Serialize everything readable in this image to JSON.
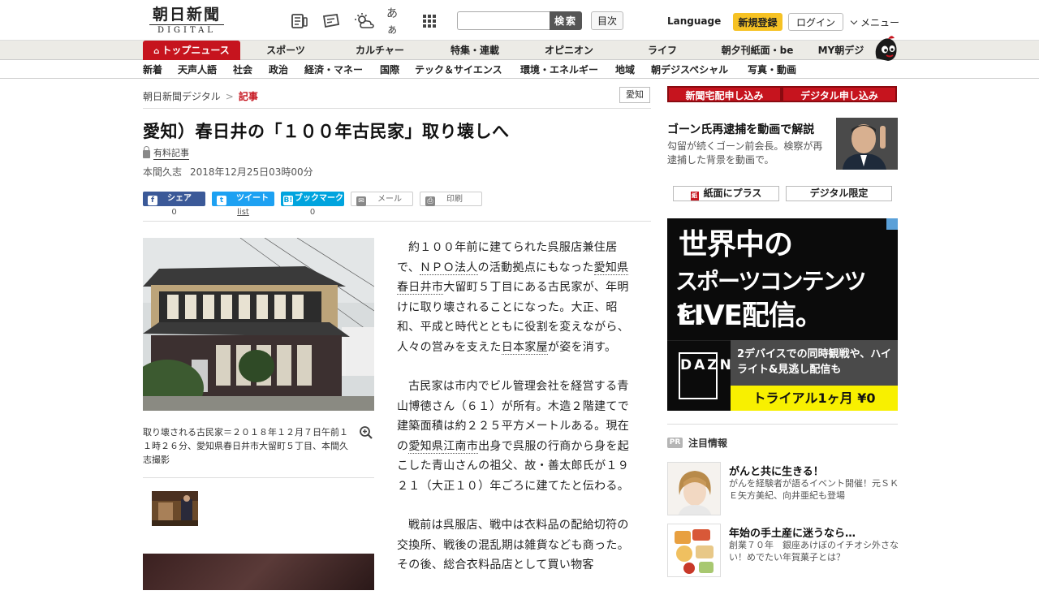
{
  "header": {
    "logo_kanji": "朝日新聞",
    "logo_sub": "DIGITAL",
    "search_placeholder": "",
    "search_button": "検索",
    "index_button": "目次",
    "language": "Language",
    "register": "新規登録",
    "login": "ログイン",
    "menu": "メニュー",
    "icons": [
      "news-feed-icon",
      "mail-paper-icon",
      "weather-icon",
      "font-size-icon",
      "grid-apps-icon"
    ],
    "font_size_glyph": "あぁ"
  },
  "main_nav": {
    "items": [
      "トップニュース",
      "スポーツ",
      "カルチャー",
      "特集・連載",
      "オピニオン",
      "ライフ",
      "朝夕刊紙面・be",
      "MY朝デジ"
    ]
  },
  "sub_nav": {
    "items": [
      "新着",
      "天声人語",
      "社会",
      "政治",
      "経済・マネー",
      "国際",
      "テック＆サイエンス",
      "環境・エネルギー",
      "地域",
      "朝デジスペシャル",
      "写真・動画"
    ]
  },
  "breadcrumb": {
    "home": "朝日新聞デジタル",
    "sep": ">",
    "current": "記事"
  },
  "region_tag": "愛知",
  "article": {
    "headline": "愛知）春日井の「１００年古民家」取り壊しへ",
    "paid_label": "有料記事",
    "author": "本間久志",
    "date": "2018年12月25日03時00分",
    "photo_caption": "取り壊される古民家＝２０１８年１２月７日午前１１時２６分、愛知県春日井市大留町５丁目、本間久志撮影",
    "para1": {
      "a": "約１００年前に建てられた呉服店兼住居で、",
      "link1": "ＮＰＯ法人",
      "b": "の活動拠点にもなった",
      "link2": "愛知県",
      "c": "",
      "link3": "春日井市",
      "d": "大留町５丁目にある古民家が、年明けに取り壊されることになった。大正、昭和、平成と時代とともに役割を変えながら、人々の営みを支えた",
      "link4": "日本家屋",
      "e": "が姿を消す。"
    },
    "para2": {
      "a": "古民家は市内でビル管理会社を経営する青山博徳さん（６１）が所有。木造２階建てで建築面積は約２２５平方メートルある。現在の",
      "link1": "愛知県",
      "b": "",
      "link2": "江南市",
      "c": "出身で呉服の行商から身を起こした青山さんの祖父、故・善太郎氏が１９２１（大正１０）年ごろに建てたと伝わる。"
    },
    "para3": "戦前は呉服店、戦中は衣料品の配給切符の交換所、戦後の混乱期は雑貨なども商った。その後、総合衣料品店として買い物客"
  },
  "share": {
    "facebook": "シェア",
    "twitter": "ツイート",
    "hatena": "ブックマーク",
    "hatena_mark": "B!",
    "mail": "メール",
    "print": "印刷",
    "facebook_count": "0",
    "twitter_count": "list",
    "hatena_count": "0"
  },
  "sidebar": {
    "btn_home_delivery": "新聞宅配申し込み",
    "btn_digital": "デジタル申し込み",
    "feature_title": "ゴーン氏再逮捕を動画で解説",
    "feature_desc": "勾留が続くゴーン前会長。検察が再逮捕した背景を動画で。",
    "btn_paper_plus": "紙面にプラス",
    "btn_digital_only": "デジタル限定",
    "ad": {
      "line1": "世界中の",
      "line2": "スポーツコンテンツを、",
      "line3": "LIVE配信。",
      "dazn": "DAZN",
      "desc": "2デバイスでの同時観戦や、ハイライト&見逃し配信も",
      "trial": "トライアル1ヶ月 ¥0"
    },
    "pr_badge": "PR",
    "pr_heading": "注目情報",
    "pr_items": [
      {
        "title": "がんと共に生きる！",
        "desc": "がんを経験者が語るイベント開催！元ＳＫＥ矢方美紀、向井亜紀も登場"
      },
      {
        "title": "年始の手土産に迷うなら…",
        "desc": "創業７０年　銀座あけぼのイチオシ外さない！めでたい年賀菓子とは？"
      }
    ]
  }
}
